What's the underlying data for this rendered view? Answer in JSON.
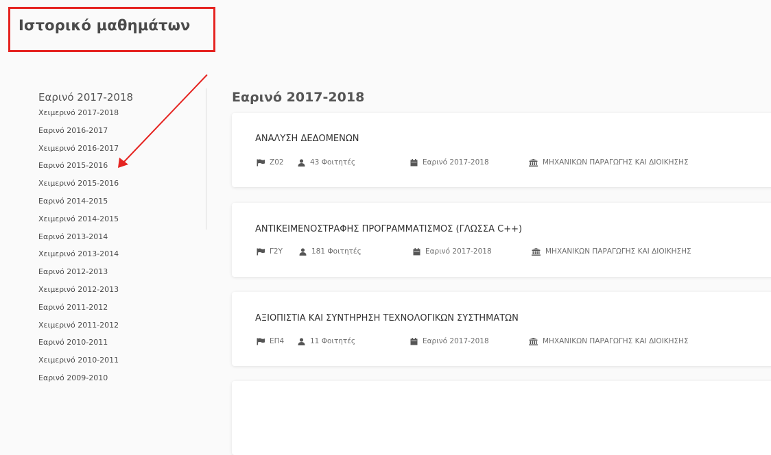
{
  "page": {
    "title": "Ιστορικό μαθημάτων"
  },
  "colors": {
    "highlight_box": "#e52421",
    "arrow": "#e52421",
    "background": "#fafafa",
    "card": "#ffffff"
  },
  "sidebar": {
    "active": "Εαρινό 2017-2018",
    "items": [
      "Χειμερινό 2017-2018",
      "Εαρινό 2016-2017",
      "Χειμερινό 2016-2017",
      "Εαρινό 2015-2016",
      "Χειμερινό 2015-2016",
      "Εαρινό 2014-2015",
      "Χειμερινό 2014-2015",
      "Εαρινό 2013-2014",
      "Χειμερινό 2013-2014",
      "Εαρινό 2012-2013",
      "Χειμερινό 2012-2013",
      "Εαρινό 2011-2012",
      "Χειμερινό 2011-2012",
      "Εαρινό 2010-2011",
      "Χειμερινό 2010-2011",
      "Εαρινό 2009-2010"
    ]
  },
  "main": {
    "heading": "Εαρινό 2017-2018",
    "courses": [
      {
        "name": "ΑΝΑΛΥΣΗ ΔΕΔΟΜΕΝΩΝ",
        "room": "Ζ02",
        "students": "43 Φοιτητές",
        "term": "Εαρινό 2017-2018",
        "department": "ΜΗΧΑΝΙΚΩΝ ΠΑΡΑΓΩΓΗΣ ΚΑΙ ΔΙΟΙΚΗΣΗΣ"
      },
      {
        "name": "ΑΝΤΙΚΕΙΜΕΝΟΣΤΡΑΦΗΣ ΠΡΟΓΡΑΜΜΑΤΙΣΜΟΣ (ΓΛΩΣΣΑ C++)",
        "room": "Γ2Υ",
        "students": "181 Φοιτητές",
        "term": "Εαρινό 2017-2018",
        "department": "ΜΗΧΑΝΙΚΩΝ ΠΑΡΑΓΩΓΗΣ ΚΑΙ ΔΙΟΙΚΗΣΗΣ"
      },
      {
        "name": "ΑΞΙΟΠΙΣΤΙΑ ΚΑΙ ΣΥΝΤΗΡΗΣΗ ΤΕΧΝΟΛΟΓΙΚΩΝ ΣΥΣΤΗΜΑΤΩΝ",
        "room": "ΕΠ4",
        "students": "11 Φοιτητές",
        "term": "Εαρινό 2017-2018",
        "department": "ΜΗΧΑΝΙΚΩΝ ΠΑΡΑΓΩΓΗΣ ΚΑΙ ΔΙΟΙΚΗΣΗΣ"
      }
    ]
  },
  "icons": {
    "room": "flag-icon",
    "students": "user-icon",
    "term": "calendar-icon",
    "department": "institution-icon"
  }
}
